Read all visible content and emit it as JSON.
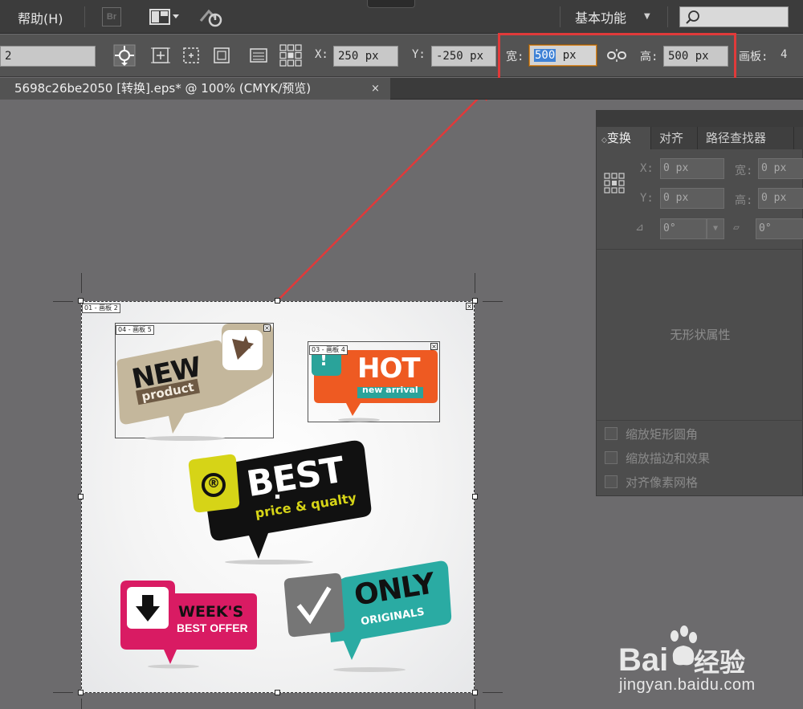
{
  "menubar": {
    "help_menu": "帮助(H)",
    "bridge_label": "Br",
    "workspace_label": "基本功能",
    "search_placeholder": ""
  },
  "controlbar": {
    "artboard_number": "2",
    "x_label": "X:",
    "x_value": "250 px",
    "y_label": "Y:",
    "y_value": "-250 px",
    "width_label": "宽:",
    "width_number": "500",
    "width_unit": "px",
    "height_label": "高:",
    "height_value": "500 px",
    "artboards_label": "画板:",
    "artboards_count": "4"
  },
  "document_tab": {
    "title": "5698c26be2050 [转换].eps* @ 100% (CMYK/预览)",
    "close": "×"
  },
  "transform_panel": {
    "tabs": [
      "变换",
      "对齐",
      "路径查找器"
    ],
    "x_label": "X:",
    "x_value": "0 px",
    "w_label": "宽:",
    "w_value": "0 px",
    "y_label": "Y:",
    "y_value": "0 px",
    "h_label": "高:",
    "h_value": "0 px",
    "rotate_value": "0°",
    "shear_value": "0°",
    "no_shape_message": "无形状属性",
    "options": [
      "缩放矩形圆角",
      "缩放描边和效果",
      "对齐像素网格"
    ]
  },
  "artboards": {
    "labels": [
      "01 - 画板 2",
      "04 - 画板 5",
      "03 - 画板 4"
    ]
  },
  "stickers": {
    "new_title": "NEW",
    "new_sub": "product",
    "hot_title": "HOT",
    "hot_sub": "new arrival",
    "hot_mark": "!",
    "best_title": "BEST",
    "best_sub": "price & qualty",
    "best_mark": "®",
    "weeks_title": "WEEK'S",
    "weeks_sub": "BEST OFFER",
    "only_title": "ONLY",
    "only_sub": "ORIGINALS"
  },
  "watermark": {
    "brand": "Bai",
    "brand2": "经验",
    "url": "jingyan.baidu.com"
  },
  "colors": {
    "highlight_red": "#e03a3a",
    "selection_blue": "#3f82d6",
    "new_beige": "#c4b79c",
    "hot_orange": "#ee5a22",
    "hot_teal": "#2aa39a",
    "best_black": "#111111",
    "best_yellow": "#d6d417",
    "weeks_pink": "#d91b63",
    "only_teal": "#2aaba3"
  }
}
